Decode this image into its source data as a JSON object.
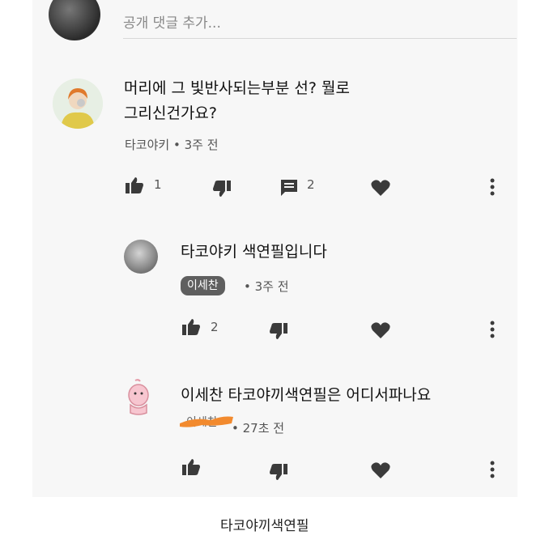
{
  "top_input": {
    "placeholder_text": "공개 댓글 추가..."
  },
  "comments": [
    {
      "text_line1": "머리에 그 빛반사되는부분 선? 뭘로",
      "text_line2": "그리신건가요?",
      "author": "타코야키",
      "time": "3주 전",
      "likes": "1",
      "replies": "2"
    }
  ],
  "replies": [
    {
      "text": "타코야키 색연필입니다",
      "author_badge": "이세찬",
      "time": "3주 전",
      "likes": "2"
    },
    {
      "text": "이세찬 타코야끼색연필은 어디서파나요",
      "author": "이세찬",
      "time": "27초 전",
      "likes": ""
    }
  ],
  "caption": "타코야끼색연필",
  "colors": {
    "panel_bg": "#f7f7f7",
    "icon": "#3b3b3b",
    "badge_bg": "#5f5f5f",
    "redaction": "#f28a2e"
  }
}
